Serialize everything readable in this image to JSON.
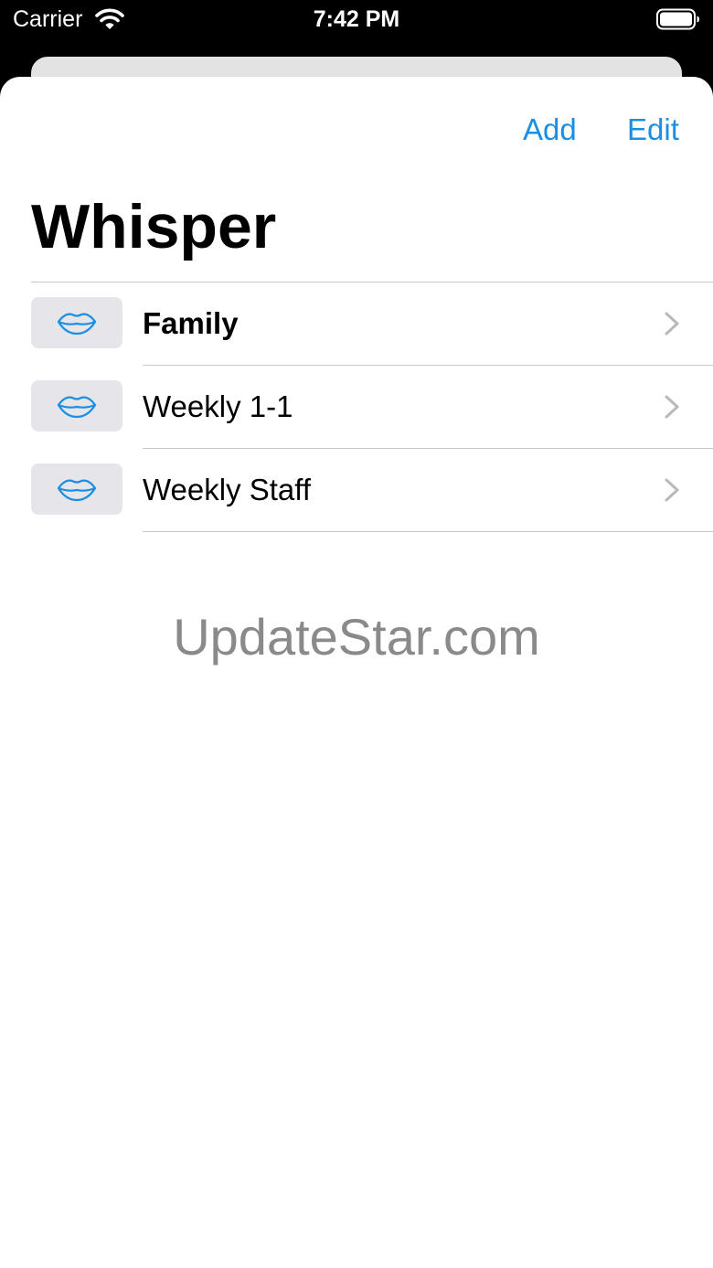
{
  "status_bar": {
    "carrier": "Carrier",
    "time": "7:42 PM",
    "icons": [
      "wifi-icon",
      "battery-icon"
    ]
  },
  "nav": {
    "add_label": "Add",
    "edit_label": "Edit"
  },
  "title": "Whisper",
  "list": {
    "items": [
      {
        "label": "Family",
        "icon": "lips-icon",
        "bold": true
      },
      {
        "label": "Weekly 1-1",
        "icon": "lips-icon",
        "bold": false
      },
      {
        "label": "Weekly Staff",
        "icon": "lips-icon",
        "bold": false
      }
    ]
  },
  "watermark": "UpdateStar.com",
  "colors": {
    "accent": "#1b8fe3",
    "icon_tile": "#e6e6ea",
    "separator": "#c8c8cc",
    "chevron": "#b8b8bd"
  }
}
